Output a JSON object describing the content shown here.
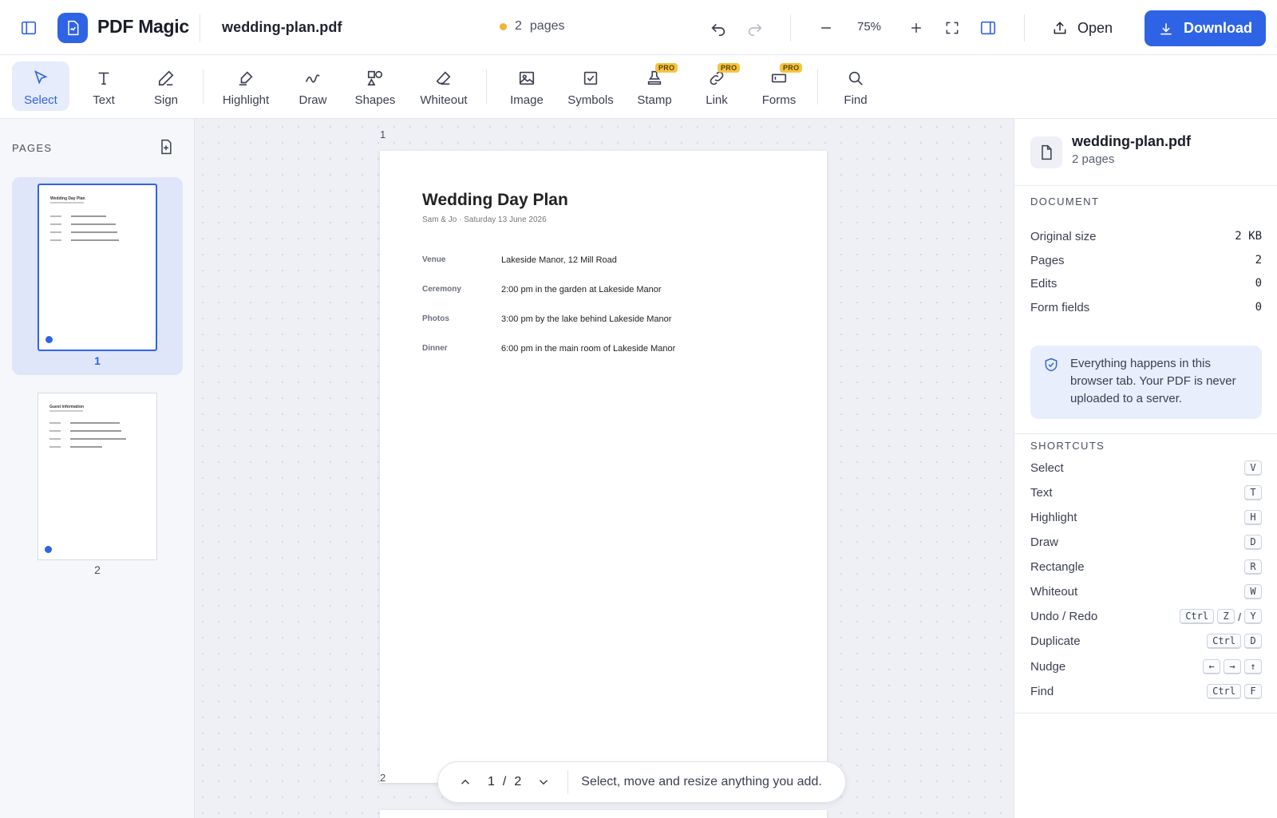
{
  "app": {
    "brand": "PDF Magic",
    "file_name": "wedding-plan.pdf",
    "page_count_number": "2",
    "page_count_label": "pages",
    "zoom": "75%",
    "open_label": "Open",
    "download_label": "Download",
    "accent": "#2f63e6"
  },
  "tools": [
    {
      "label": "Select",
      "icon": "cursor-icon",
      "active": true
    },
    {
      "label": "Text",
      "icon": "text-icon"
    },
    {
      "label": "Sign",
      "icon": "pen-icon",
      "caret": true
    },
    {
      "label": "Highlight",
      "icon": "highlighter-icon",
      "caret": true
    },
    {
      "label": "Draw",
      "icon": "squiggle-icon"
    },
    {
      "label": "Shapes",
      "icon": "shapes-icon",
      "caret": true
    },
    {
      "label": "Whiteout",
      "icon": "eraser-icon"
    },
    {
      "label": "Image",
      "icon": "image-icon"
    },
    {
      "label": "Symbols",
      "icon": "checkbox-icon",
      "caret": true
    },
    {
      "label": "Stamp",
      "icon": "stamp-icon",
      "caret": true,
      "badge": "PRO"
    },
    {
      "label": "Link",
      "icon": "link-icon",
      "badge": "PRO"
    },
    {
      "label": "Forms",
      "icon": "form-icon",
      "caret": true,
      "badge": "PRO"
    },
    {
      "label": "Find",
      "icon": "search-icon"
    }
  ],
  "left_panel": {
    "title": "PAGES",
    "thumbs": [
      {
        "num": "1",
        "title": "Wedding Day Plan"
      },
      {
        "num": "2",
        "title": "Guest Information"
      }
    ]
  },
  "canvas": {
    "page1_label": "1",
    "page2_label": "2",
    "doc": {
      "title": "Wedding Day Plan",
      "subtitle": "Sam & Jo  ·  Saturday 13 June 2026",
      "rows": [
        {
          "key": "Venue",
          "value": "Lakeside Manor, 12 Mill Road"
        },
        {
          "key": "Ceremony",
          "value": "2:00 pm in the garden at Lakeside Manor"
        },
        {
          "key": "Photos",
          "value": "3:00 pm by the lake behind Lakeside Manor"
        },
        {
          "key": "Dinner",
          "value": "6:00 pm in the main room of Lakeside Manor"
        }
      ]
    },
    "pager": {
      "current": "1",
      "sep": "/",
      "total": "2",
      "hint": "Select, move and resize anything you add."
    }
  },
  "right_panel": {
    "file_name": "wedding-plan.pdf",
    "file_pages": "2 pages",
    "document_title": "DOCUMENT",
    "stats": [
      {
        "label": "Original size",
        "value": "2 KB"
      },
      {
        "label": "Pages",
        "value": "2"
      },
      {
        "label": "Edits",
        "value": "0"
      },
      {
        "label": "Form fields",
        "value": "0"
      }
    ],
    "privacy": "Everything happens in this browser tab. Your PDF is never uploaded to a server.",
    "shortcuts_title": "SHORTCUTS",
    "shortcuts": [
      {
        "label": "Select",
        "keys": [
          "V"
        ]
      },
      {
        "label": "Text",
        "keys": [
          "T"
        ]
      },
      {
        "label": "Highlight",
        "keys": [
          "H"
        ]
      },
      {
        "label": "Draw",
        "keys": [
          "D"
        ]
      },
      {
        "label": "Rectangle",
        "keys": [
          "R"
        ]
      },
      {
        "label": "Whiteout",
        "keys": [
          "W"
        ]
      },
      {
        "label": "Undo / Redo",
        "keys": [
          "Ctrl",
          "Z",
          "/",
          "Y"
        ]
      },
      {
        "label": "Duplicate",
        "keys": [
          "Ctrl",
          "D"
        ]
      },
      {
        "label": "Nudge",
        "keys": [
          "←",
          "→",
          "↑"
        ]
      },
      {
        "label": "Find",
        "keys": [
          "Ctrl",
          "F"
        ]
      }
    ]
  }
}
